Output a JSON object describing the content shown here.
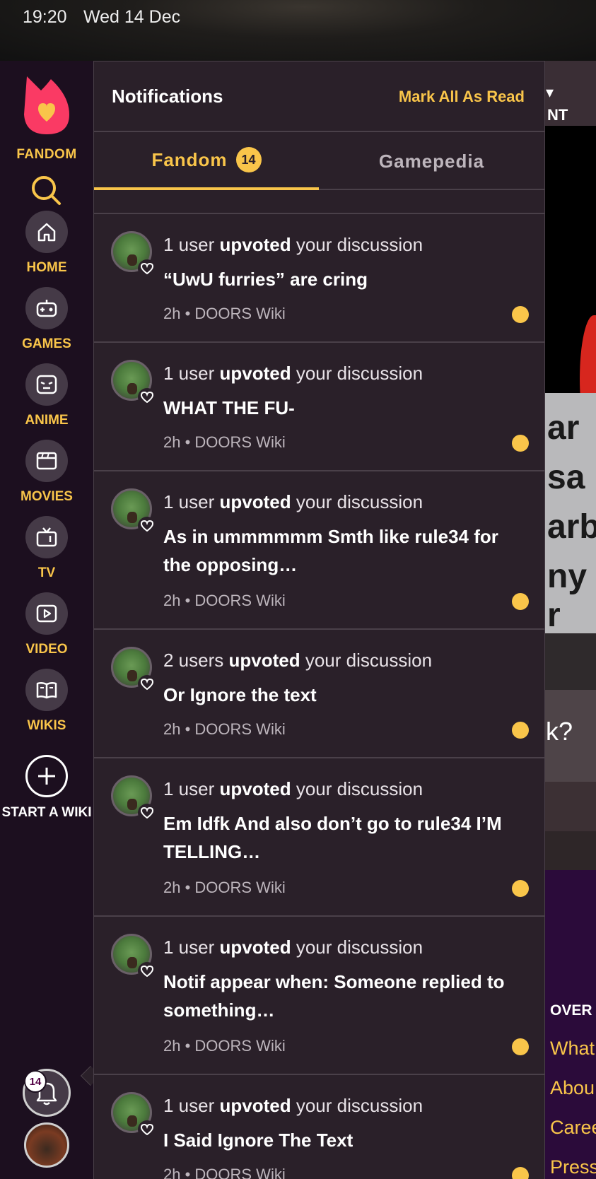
{
  "status_bar": {
    "time": "19:20",
    "date": "Wed 14 Dec"
  },
  "sidebar": {
    "logo_text": "FANDOM",
    "items": [
      {
        "label": "HOME",
        "icon": "home-icon"
      },
      {
        "label": "GAMES",
        "icon": "gamepad-icon"
      },
      {
        "label": "ANIME",
        "icon": "anime-face-icon"
      },
      {
        "label": "MOVIES",
        "icon": "clapperboard-icon"
      },
      {
        "label": "TV",
        "icon": "tv-icon"
      },
      {
        "label": "VIDEO",
        "icon": "play-icon"
      },
      {
        "label": "WIKIS",
        "icon": "book-icon"
      }
    ],
    "start_wiki_label": "START A WIKI",
    "notification_count": "14"
  },
  "panel": {
    "title": "Notifications",
    "mark_all": "Mark All As Read",
    "tabs": [
      {
        "label": "Fandom",
        "badge": "14",
        "active": true
      },
      {
        "label": "Gamepedia",
        "active": false
      }
    ],
    "notifications": [
      {
        "count": "1 user",
        "verb": "upvoted",
        "rest": "your discussion",
        "title": "“UwU furries” are cring",
        "meta": "2h • DOORS Wiki"
      },
      {
        "count": "1 user",
        "verb": "upvoted",
        "rest": "your discussion",
        "title": "WHAT THE FU-",
        "meta": "2h • DOORS Wiki"
      },
      {
        "count": "1 user",
        "verb": "upvoted",
        "rest": "your discussion",
        "title": "As in ummmmmm Smth like rule34 for the opposing…",
        "meta": "2h • DOORS Wiki"
      },
      {
        "count": "2 users",
        "verb": "upvoted",
        "rest": "your discussion",
        "title": "Or Ignore the text",
        "meta": "2h • DOORS Wiki"
      },
      {
        "count": "1 user",
        "verb": "upvoted",
        "rest": "your discussion",
        "title": "Em Idfk And also don’t go to rule34 I’M TELLING…",
        "meta": "2h • DOORS Wiki"
      },
      {
        "count": "1 user",
        "verb": "upvoted",
        "rest": "your discussion",
        "title": "Notif appear when: Someone replied to something…",
        "meta": "2h • DOORS Wiki"
      },
      {
        "count": "1 user",
        "verb": "upvoted",
        "rest": "your discussion",
        "title": "I Said Ignore The Text",
        "meta": "2h • DOORS Wiki"
      }
    ]
  },
  "background_page": {
    "account_fragment": "NT",
    "photo_text": [
      "ar",
      "sa",
      "arb",
      "ny r"
    ],
    "question_fragment": "k?",
    "footer_heading": "OVER",
    "footer_links": [
      "What",
      "Abou",
      "Caree",
      "Press"
    ]
  },
  "colors": {
    "accent": "#f9c54a",
    "panel_bg": "#2a2029",
    "sidebar_bg": "#1c0f1f",
    "logo": "#fa3a64"
  }
}
